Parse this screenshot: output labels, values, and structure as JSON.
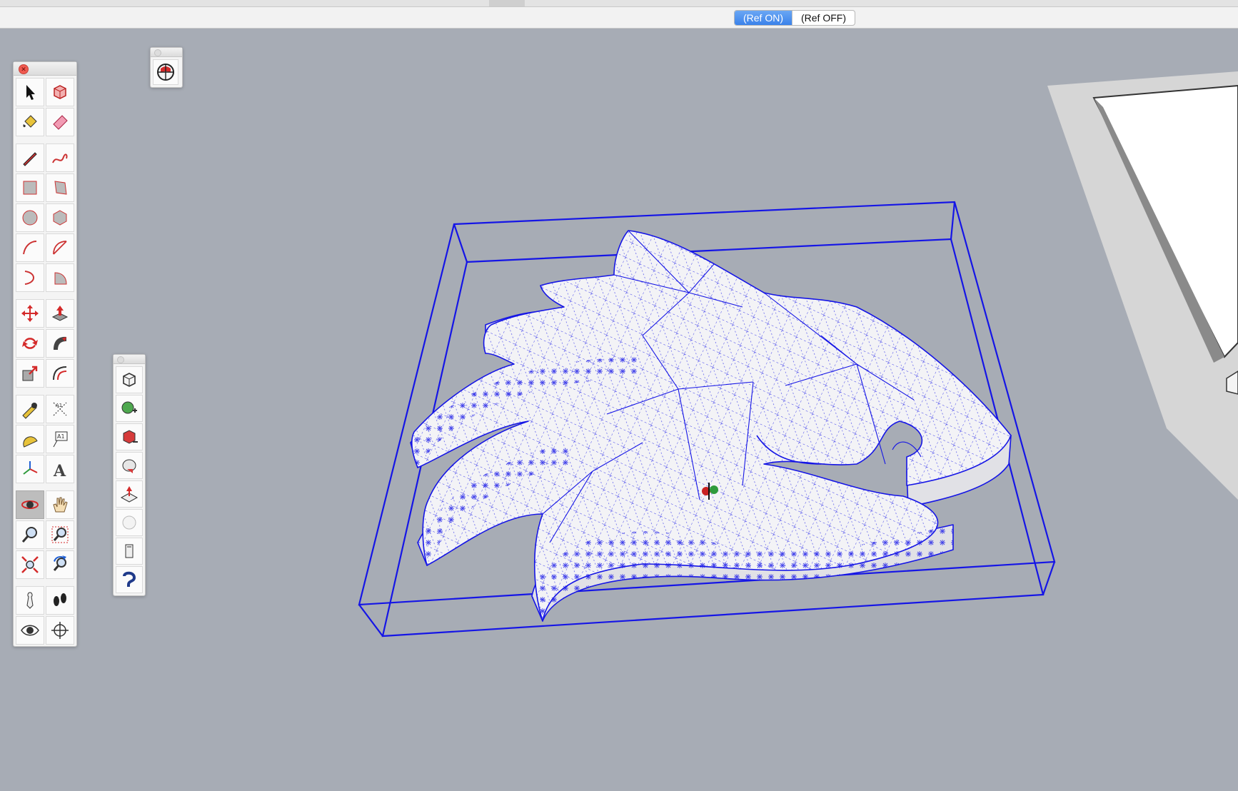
{
  "app": {
    "name": "SketchUp 3D modeling viewport"
  },
  "reference_toggle": {
    "on_label": "(Ref ON)",
    "off_label": "(Ref OFF)",
    "selected": "on"
  },
  "palettes": {
    "main_tools": {
      "groups": [
        [
          "select-tool",
          "make-component-tool"
        ],
        [
          "paint-bucket-tool",
          "eraser-tool"
        ],
        [
          "line-tool",
          "freehand-tool"
        ],
        [
          "rectangle-tool",
          "rotated-rectangle-tool"
        ],
        [
          "circle-tool",
          "polygon-tool"
        ],
        [
          "arc-tool",
          "two-point-arc-tool"
        ],
        [
          "three-point-arc-tool",
          "pie-tool"
        ],
        [
          "move-tool",
          "push-pull-tool"
        ],
        [
          "rotate-tool",
          "follow-me-tool"
        ],
        [
          "scale-tool",
          "offset-tool"
        ],
        [
          "tape-measure-tool",
          "dimension-tool"
        ],
        [
          "protractor-tool",
          "text-tool"
        ],
        [
          "axes-tool",
          "3d-text-tool"
        ],
        [
          "orbit-tool",
          "pan-tool"
        ],
        [
          "zoom-tool",
          "zoom-window-tool"
        ],
        [
          "zoom-extents-tool",
          "previous-view-tool"
        ],
        [
          "position-camera-tool",
          "walk-tool"
        ],
        [
          "look-around-tool",
          "section-plane-tool"
        ]
      ]
    },
    "geo_tools": {
      "items": [
        "add-location-icon"
      ]
    },
    "solid_tools": {
      "items": [
        "outer-shell-tool",
        "union-tool",
        "subtract-tool",
        "trim-tool",
        "intersect-tool",
        "split-tool",
        "solid-inspector-tool",
        "hide-show-tool"
      ]
    }
  },
  "colors": {
    "viewport_bg": "#a7acb5",
    "selection_blue": "#1515e6",
    "toggle_accent": "#3b82ea"
  }
}
